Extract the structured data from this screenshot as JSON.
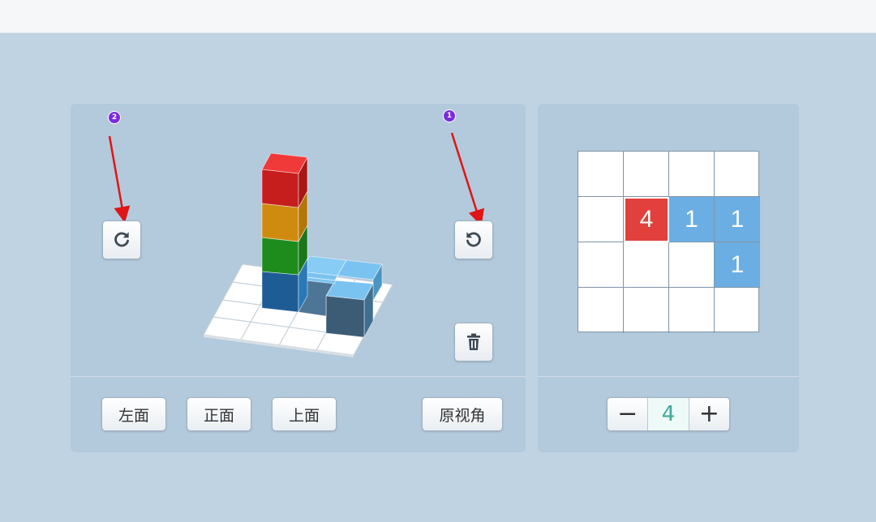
{
  "markers": {
    "left": "2",
    "right": "1"
  },
  "colors": {
    "background": "#c0d3e2",
    "panel": "#b3c9dc",
    "red": "#e2403c",
    "blue": "#6aaee3",
    "marker": "#7a2be0",
    "stepper_value": "#3fa89a"
  },
  "left_panel": {
    "rotate_cw_icon": "rotate-clockwise-icon",
    "rotate_ccw_icon": "rotate-counterclockwise-icon",
    "delete_icon": "trash-icon",
    "buttons": {
      "left": "左面",
      "front": "正面",
      "top": "上面",
      "reset": "原视角"
    }
  },
  "right_panel": {
    "grid": [
      [
        "",
        "",
        "",
        ""
      ],
      [
        "",
        "4",
        "1",
        "1"
      ],
      [
        "",
        "",
        "",
        "1"
      ],
      [
        "",
        "",
        "",
        ""
      ]
    ],
    "stepper": {
      "minus": "−",
      "value": "4",
      "plus": "+"
    }
  }
}
